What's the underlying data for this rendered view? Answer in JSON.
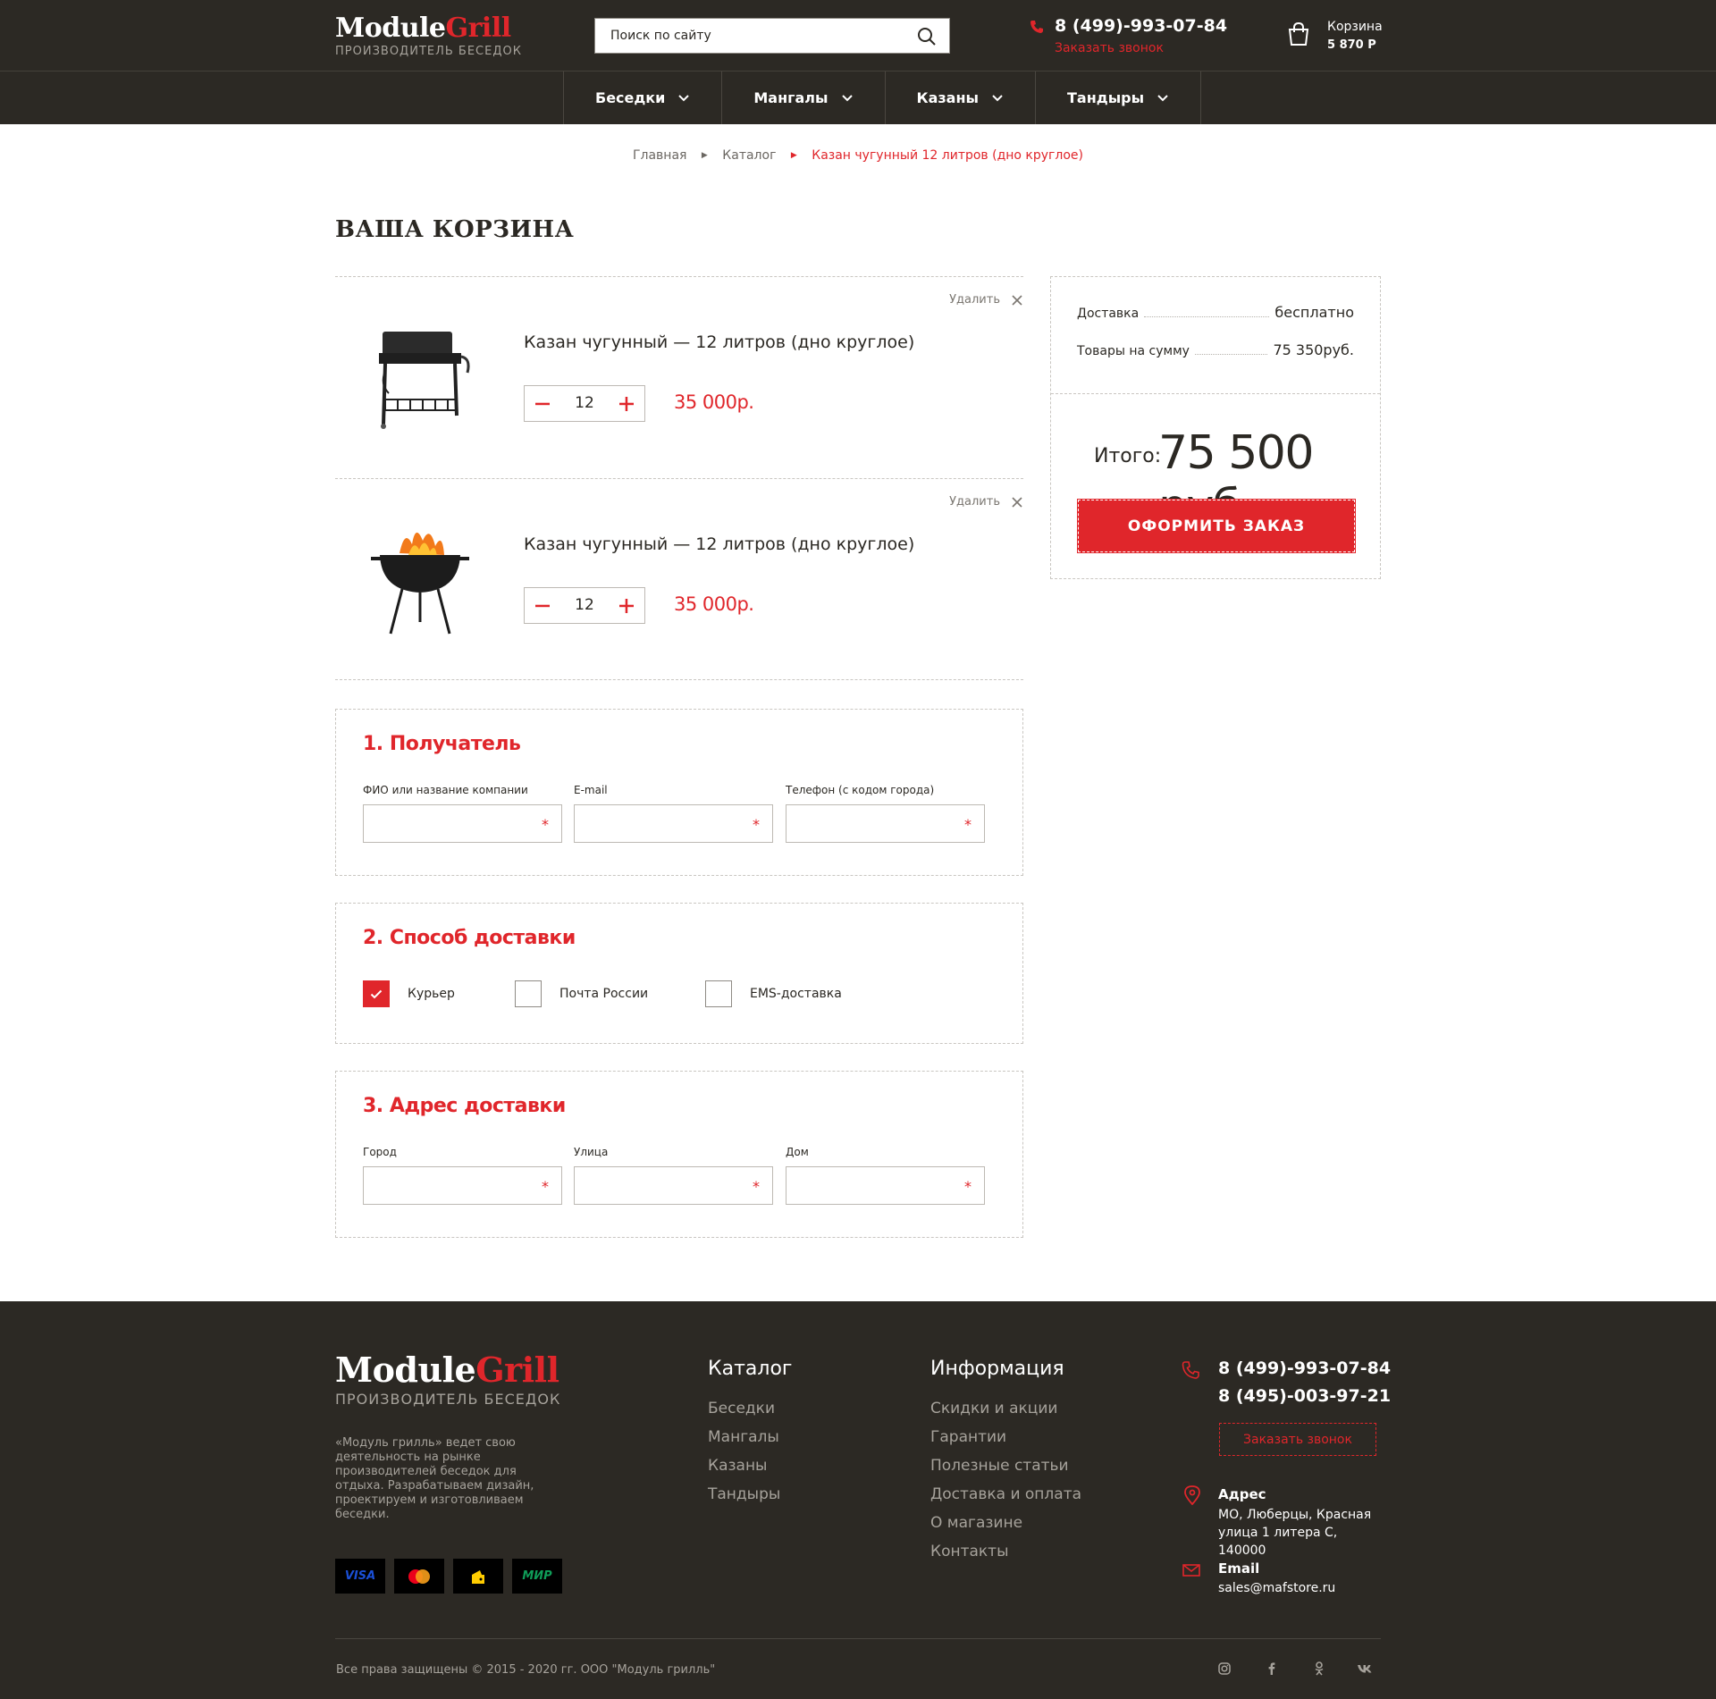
{
  "header": {
    "logo_main": "Module",
    "logo_accent": "Grill",
    "logo_sub": "ПРОИЗВОДИТЕЛЬ БЕСЕДОК",
    "search_placeholder": "Поиск по сайту",
    "phone": "8 (499)-993-07-84",
    "callback": "Заказать звонок",
    "cart_label": "Корзина",
    "cart_sum": "5 870 Р"
  },
  "nav": {
    "items": [
      {
        "label": "Беседки"
      },
      {
        "label": "Мангалы"
      },
      {
        "label": "Казаны"
      },
      {
        "label": "Тандыры"
      }
    ]
  },
  "breadcrumbs": [
    "Главная",
    "Каталог",
    "Казан чугунный 12 литров (дно круглое)"
  ],
  "page_title": "ВАША КОРЗИНА",
  "cart": {
    "remove_label": "Удалить",
    "items": [
      {
        "title": "Казан чугунный — 12 литров (дно круглое)",
        "qty": "12",
        "price": "35 000р.",
        "image": "grill-cart-image"
      },
      {
        "title": "Казан чугунный — 12 литров (дно круглое)",
        "qty": "12",
        "price": "35 000р.",
        "image": "kettle-grill-fire-image"
      }
    ]
  },
  "summary": {
    "delivery_label": "Доставка",
    "delivery_value": "бесплатно",
    "goods_label": "Товары на сумму",
    "goods_value": "75 350руб.",
    "total_label": "Итого:",
    "total_value": "75 500 руб.",
    "order_button": "ОФОРМИТЬ ЗАКАЗ"
  },
  "recipient": {
    "title": "1. Получатель",
    "fields": [
      {
        "label": "ФИО или название компании",
        "required": "*"
      },
      {
        "label": "E-mail",
        "required": "*"
      },
      {
        "label": "Телефон (с кодом города)",
        "required": "*"
      }
    ]
  },
  "delivery": {
    "title": "2. Способ доставки",
    "options": [
      {
        "label": "Курьер",
        "checked": true
      },
      {
        "label": "Почта России",
        "checked": false
      },
      {
        "label": "EMS-доставка",
        "checked": false
      }
    ]
  },
  "address": {
    "title": "3. Адрес доставки",
    "fields": [
      {
        "label": "Город",
        "required": "*"
      },
      {
        "label": "Улица",
        "required": "*"
      },
      {
        "label": "Дом",
        "required": "*"
      }
    ]
  },
  "footer": {
    "about": "«Модуль грилль» ведет свою деятельность на  рынке производителей беседок для отдыха. Разрабатываем дизайн, проектируем и изготовливаем беседки.",
    "payments": [
      "VISA",
      "mastercard-icon",
      "yandex-money-icon",
      "МИР"
    ],
    "catalog_title": "Каталог",
    "catalog_links": [
      "Беседки",
      "Мангалы",
      "Казаны",
      "Тандыры"
    ],
    "info_title": "Информация",
    "info_links": [
      "Скидки и акции",
      "Гарантии",
      "Полезные статьи",
      "Доставка и оплата",
      "О магазине",
      "Контакты"
    ],
    "phone1": "8 (499)-993-07-84",
    "phone2": "8 (495)-003-97-21",
    "callback": "Заказать звонок",
    "address_label": "Адрес",
    "address_text": "МО, Люберцы, Красная улица 1 литера С, 140000",
    "email_label": "Email",
    "email": "sales@mafstore.ru",
    "copyright": "Все права защищены © 2015 - 2020 гг. ООО \"Модуль грилль\"",
    "socials": [
      "instagram-icon",
      "facebook-icon",
      "odnoklassniki-icon",
      "vk-icon"
    ]
  },
  "colors": {
    "accent": "#e0262b",
    "dark": "#2c2924",
    "muted": "#a6a29b"
  }
}
